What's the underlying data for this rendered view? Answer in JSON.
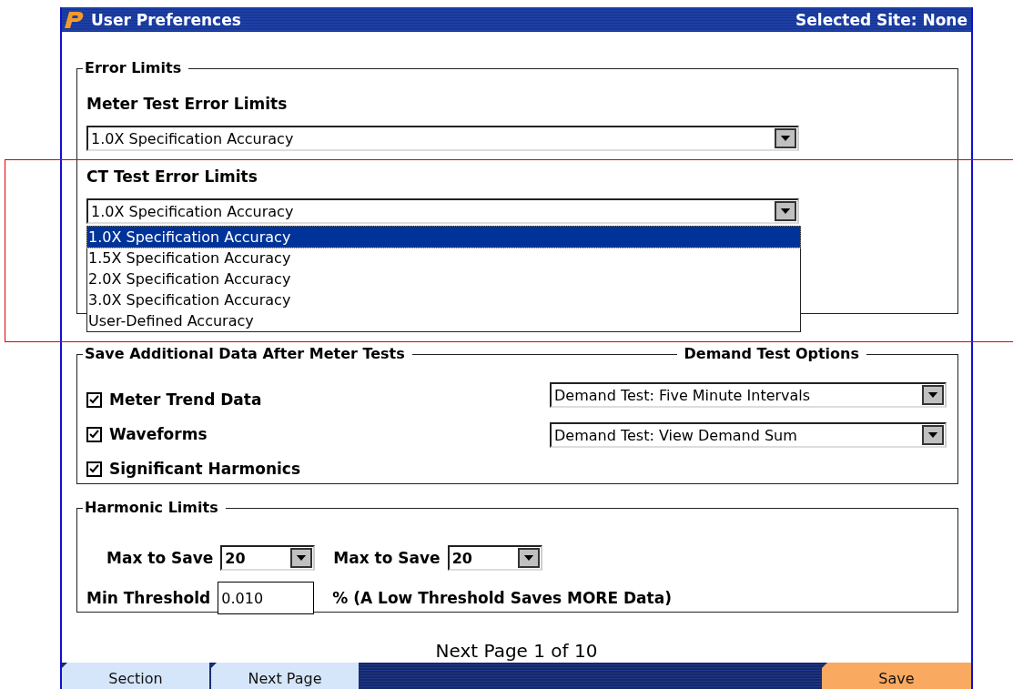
{
  "window": {
    "title": "User Preferences",
    "site": "Selected Site: None"
  },
  "error_limits": {
    "legend": "Error Limits",
    "fields": [
      {
        "label": "Meter Test Error Limits",
        "value": "1.0X Specification Accuracy"
      },
      {
        "label": "CT Test Error Limits",
        "value": "1.0X Specification Accuracy",
        "expanded": true,
        "options": [
          {
            "label": "1.0X Specification Accuracy",
            "selected": true
          },
          {
            "label": "1.5X Specification Accuracy",
            "selected": false
          },
          {
            "label": "2.0X Specification Accuracy",
            "selected": false
          },
          {
            "label": "3.0X Specification Accuracy",
            "selected": false
          },
          {
            "label": "User-Defined Accuracy",
            "selected": false
          }
        ]
      }
    ]
  },
  "save_data": {
    "legend": "Save Additional Data After Meter Tests",
    "items": [
      {
        "label": "Meter Trend Data",
        "checked": true
      },
      {
        "label": "Waveforms",
        "checked": true
      },
      {
        "label": "Significant Harmonics",
        "checked": true
      }
    ]
  },
  "demand": {
    "legend": "Demand Test Options",
    "selects": [
      {
        "value": "Demand Test: Five Minute Intervals"
      },
      {
        "value": "Demand Test: View Demand Sum"
      }
    ]
  },
  "harmonic": {
    "legend": "Harmonic Limits",
    "max_fields": [
      {
        "label": "Max to Save",
        "value": "20"
      },
      {
        "label": "Max to Save",
        "value": "20"
      }
    ],
    "threshold": {
      "label": "Min Threshold",
      "value": "0.010",
      "note": "% (A Low Threshold Saves MORE Data)"
    }
  },
  "pager": "Next Page 1 of 10",
  "tabs": [
    {
      "label": "Section",
      "kind": "tab"
    },
    {
      "label": "Next Page",
      "kind": "tab"
    },
    {
      "label": "Save",
      "kind": "action"
    }
  ],
  "highlight": true
}
